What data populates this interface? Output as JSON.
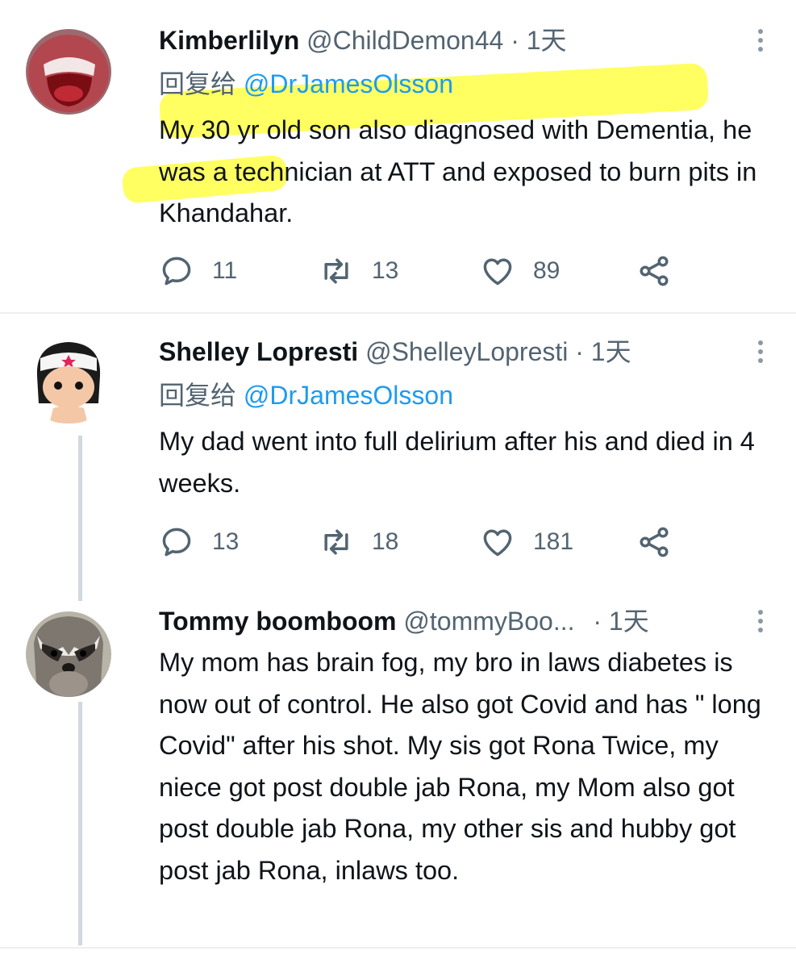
{
  "tweets": [
    {
      "name": "Kimberlilyn",
      "handle": "@ChildDemon44",
      "sep": "·",
      "time": "1天",
      "reply_prefix": "回复给",
      "reply_to": "@DrJamesOlsson",
      "text": "My 30 yr old son also diagnosed with Dementia, he was a technician at ATT and exposed to burn pits in Khandahar.",
      "replies": "11",
      "retweets": "13",
      "likes": "89"
    },
    {
      "name": "Shelley Lopresti",
      "handle": "@ShelleyLopresti",
      "sep": "·",
      "time": "1天",
      "reply_prefix": "回复给",
      "reply_to": "@DrJamesOlsson",
      "text": "My dad went into full delirium after his and died in 4 weeks.",
      "replies": "13",
      "retweets": "18",
      "likes": "181"
    },
    {
      "name": "Tommy boomboom",
      "handle": "@tommyBoo...",
      "sep": "·",
      "time": "1天",
      "text": "My mom has brain fog, my bro in laws diabetes is now out of control. He also got Covid and has \" long Covid\" after his shot. My sis got Rona Twice, my niece got post double jab Rona, my Mom also got post double jab Rona, my other sis and hubby got post jab Rona, inlaws too."
    }
  ],
  "colors": {
    "highlight": "#ffff00",
    "mention": "#1d9bf0",
    "muted": "#536471"
  }
}
